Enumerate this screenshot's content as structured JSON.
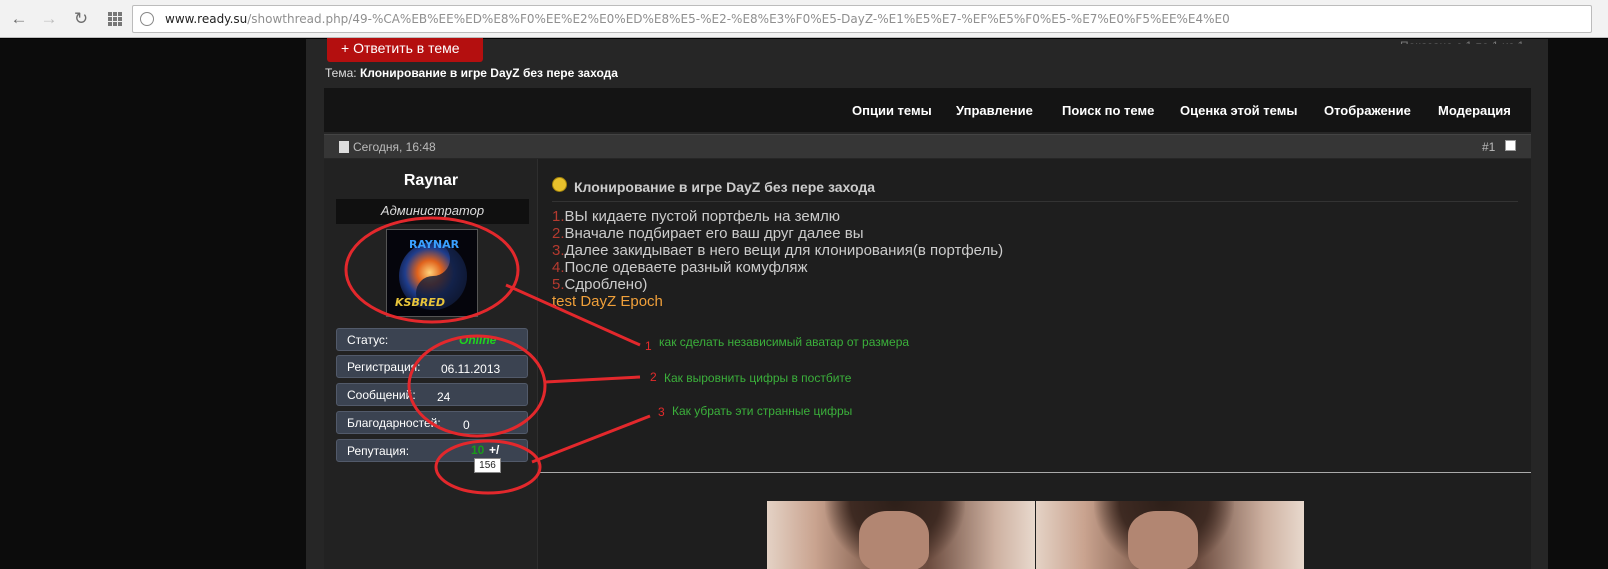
{
  "browser": {
    "url_host": "www.ready.su",
    "url_path": "/showthread.php/49-%CA%EB%EE%ED%E8%F0%EE%E2%E0%ED%E8%E5-%E2-%E8%E3%F0%E5-DayZ-%E1%E5%E7-%EF%E5%F0%E5-%E7%E0%F5%EE%E4%E0"
  },
  "forum": {
    "reply_button": "+ Ответить в теме",
    "thread_label": "Тема:",
    "thread_title": "Клонирование в игре DayZ без пере захода",
    "toolbar": [
      "Опции темы",
      "Управление",
      "Поиск по теме",
      "Оценка этой темы",
      "Отображение",
      "Модерация"
    ]
  },
  "post": {
    "date": "Сегодня, 16:48",
    "number": "#1",
    "title": "Клонирование в игре DayZ без пере захода",
    "lines": [
      {
        "n": "1.",
        "t": "ВЫ кидаете пустой портфель на землю"
      },
      {
        "n": "2.",
        "t": "Вначале подбирает его ваш друг далее вы"
      },
      {
        "n": "3.",
        "t": "Далее закидывает в него вещи для клонирования(в портфель)"
      },
      {
        "n": "4.",
        "t": "После одеваете разный комуфляж"
      },
      {
        "n": "5.",
        "t": "Сдроблено)"
      }
    ],
    "signature": "test DayZ Epoch"
  },
  "user": {
    "name": "Raynar",
    "title": "Администратор",
    "avatar_text_top": "RAYNAR",
    "avatar_text_bottom": "KSBRED",
    "status_label": "Статус:",
    "status_value": "Online",
    "reg_label": "Регистрация:",
    "reg_value": "06.11.2013",
    "posts_label": "Сообщений:",
    "posts_value": "24",
    "thanks_label": "Благодарностей:",
    "thanks_value": "0",
    "rep_label": "Репутация:",
    "rep_value": "10",
    "rep_suffix": "+/",
    "tooltip": "156"
  },
  "annotations": [
    {
      "num": "1",
      "text": "как сделать независимый аватар от размера"
    },
    {
      "num": "2",
      "text": "Как выровнить цифры в постбите"
    },
    {
      "num": "3",
      "text": "Как убрать эти странные цифры"
    }
  ],
  "colors": {
    "annotation_red": "#e3282c",
    "annotation_green": "#3bb03b",
    "reply_red": "#b40f0f",
    "online_green": "#1fd21f"
  }
}
